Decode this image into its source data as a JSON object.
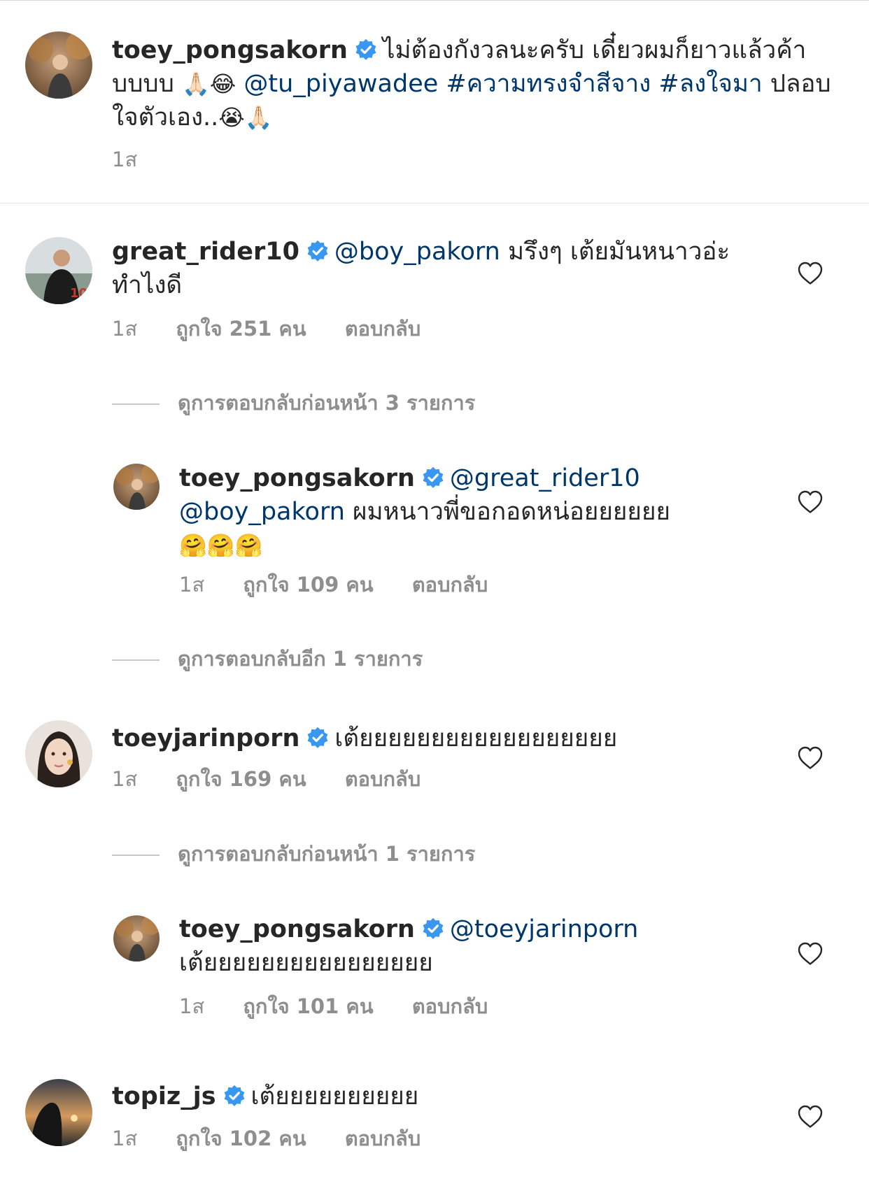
{
  "caption": {
    "username": "toey_pongsakorn",
    "text_1": "ไม่ต้องกังวลนะครับ เดี๋ยวผมก็ยาวแล้วค้าบบบบ",
    "emoji_1": "🙏🏻😂",
    "mention": "@tu_piyawadee",
    "hashtag_1": "#ความทรงจำสีจาง",
    "hashtag_2": "#ลงใจมา",
    "text_2": "ปลอบใจตัวเอง..",
    "emoji_2": "😭🙏🏻",
    "time": "1ส"
  },
  "comments": [
    {
      "username": "great_rider10",
      "mention": "@boy_pakorn",
      "text": "มรึงๆ เต้ยมันหนาวอ่ะ ทำไงดี",
      "time": "1ส",
      "likes": "ถูกใจ 251 คน",
      "reply": "ตอบกลับ",
      "view_replies": "ดูการตอบกลับก่อนหน้า 3 รายการ",
      "replies": [
        {
          "username": "toey_pongsakorn",
          "mention_1": "@great_rider10",
          "mention_2": "@boy_pakorn",
          "text": "ผมหนาวพี่ขอกอดหน่อยยยยยย",
          "emoji": "🤗🤗🤗",
          "time": "1ส",
          "likes": "ถูกใจ 109 คน",
          "reply": "ตอบกลับ"
        }
      ],
      "view_more": "ดูการตอบกลับอีก 1 รายการ"
    },
    {
      "username": "toeyjarinporn",
      "text": "เต้ยยยยยยยยยยยยยยยยยย",
      "time": "1ส",
      "likes": "ถูกใจ 169 คน",
      "reply": "ตอบกลับ",
      "view_replies": "ดูการตอบกลับก่อนหน้า 1 รายการ",
      "replies": [
        {
          "username": "toey_pongsakorn",
          "mention": "@toeyjarinporn",
          "text": "เต้ยยยยยยยยยยยยยยยย",
          "time": "1ส",
          "likes": "ถูกใจ 101 คน",
          "reply": "ตอบกลับ"
        }
      ]
    },
    {
      "username": "topiz_js",
      "text": "เต้ยยยยยยยยยย",
      "time": "1ส",
      "likes": "ถูกใจ 102 คน",
      "reply": "ตอบกลับ"
    }
  ],
  "colors": {
    "verified": "#3897f0",
    "link": "#00376b",
    "meta": "#8e8e8e"
  }
}
